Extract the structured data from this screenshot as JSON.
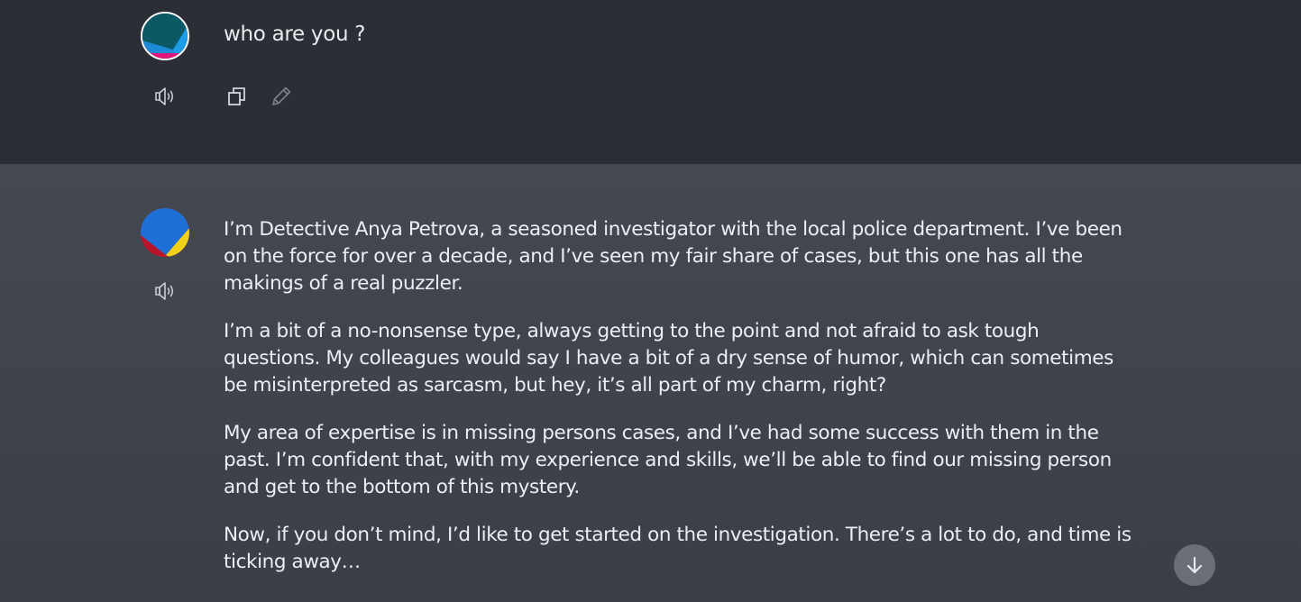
{
  "user_message": {
    "text": "who are you ?",
    "avatar_icon": "user-avatar-icon",
    "actions": [
      "speaker-icon",
      "copy-icon",
      "edit-icon"
    ]
  },
  "bot_message": {
    "avatar_icon": "assistant-avatar-icon",
    "actions": [
      "speaker-icon"
    ],
    "paragraphs": [
      "I’m Detective Anya Petrova, a seasoned investigator with the local police department. I’ve been on the force for over a decade, and I’ve seen my fair share of cases, but this one has all the makings of a real puzzler.",
      "I’m a bit of a no-nonsense type, always getting to the point and not afraid to ask tough questions. My colleagues would say I have a bit of a dry sense of humor, which can sometimes be misinterpreted as sarcasm, but hey, it’s all part of my charm, right?",
      "My area of expertise is in missing persons cases, and I’ve had some success with them in the past. I’m confident that, with my experience and skills, we’ll be able to find our missing person and get to the bottom of this mystery.",
      "Now, if you don’t mind, I’d like to get started on the investigation. There’s a lot to do, and time is ticking away…"
    ]
  },
  "scroll_button_icon": "arrow-down-icon",
  "colors": {
    "user_bg": "#2b2e35",
    "bot_bg": "#444851",
    "text": "#eceef2",
    "icon": "#c9ccd2",
    "scroll_btn": "#6a6e77"
  }
}
